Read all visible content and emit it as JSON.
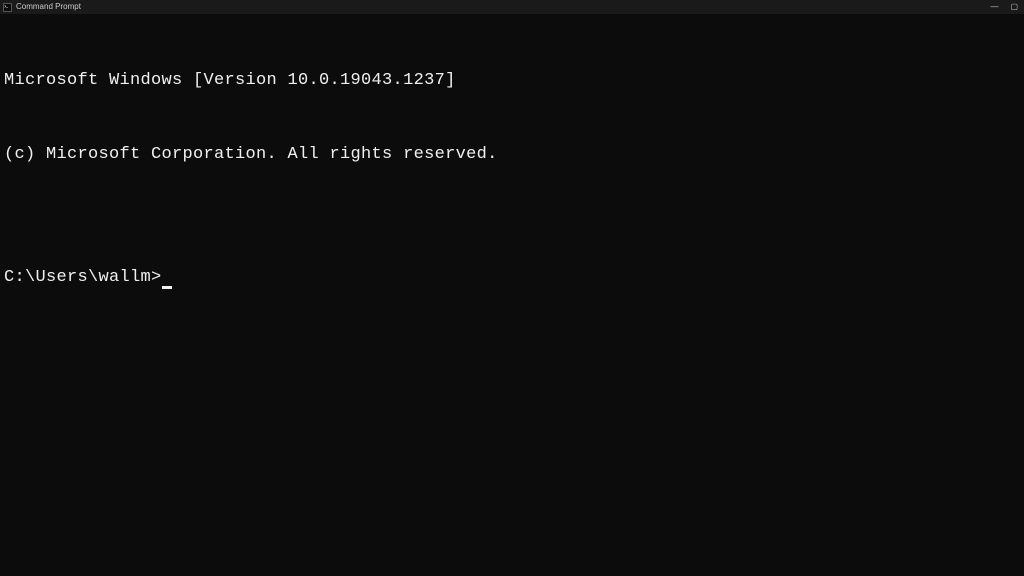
{
  "titlebar": {
    "title": "Command Prompt",
    "minimize": "—",
    "maximize": "▢"
  },
  "terminal": {
    "line1": "Microsoft Windows [Version 10.0.19043.1237]",
    "line2": "(c) Microsoft Corporation. All rights reserved.",
    "blank": "",
    "prompt": "C:\\Users\\wallm>"
  }
}
